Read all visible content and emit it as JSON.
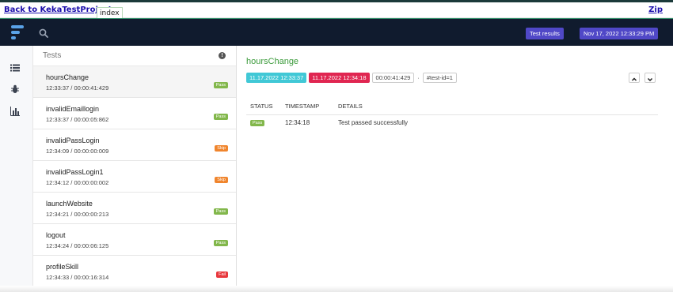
{
  "topbar": {
    "back_link": "Back to KekaTestProject",
    "tab_label": "index",
    "zip_link": "Zip"
  },
  "navbar": {
    "test_results_label": "Test results",
    "date_label": "Nov 17, 2022 12:33:29 PM"
  },
  "test_list": {
    "header": "Tests",
    "items": [
      {
        "name": "hoursChange",
        "time": "12:33:37 / 00:00:41:429",
        "status": "Pass"
      },
      {
        "name": "invalidEmaillogin",
        "time": "12:33:37 / 00:00:05:862",
        "status": "Pass"
      },
      {
        "name": "invalidPassLogin",
        "time": "12:34:09 / 00:00:00:009",
        "status": "Skip"
      },
      {
        "name": "invalidPassLogin1",
        "time": "12:34:12 / 00:00:00:002",
        "status": "Skip"
      },
      {
        "name": "launchWebsite",
        "time": "12:34:21 / 00:00:00:213",
        "status": "Pass"
      },
      {
        "name": "logout",
        "time": "12:34:24 / 00:00:06:125",
        "status": "Pass"
      },
      {
        "name": "profileSkill",
        "time": "12:34:33 / 00:00:16:314",
        "status": "Fail"
      }
    ]
  },
  "detail": {
    "title": "hoursChange",
    "start": "11.17.2022 12:33:37",
    "end": "11.17.2022 12:34:18",
    "duration": "00:00:41:429",
    "separator": "·",
    "test_id": "#test-id=1",
    "columns": {
      "status": "STATUS",
      "timestamp": "TIMESTAMP",
      "details": "DETAILS"
    },
    "log": {
      "status": "Pass",
      "timestamp": "12:34:18",
      "details": "Test passed successfully"
    }
  },
  "colors": {
    "navbar_bg": "#101b2e",
    "accent_purple": "#5048c7",
    "pass": "#82b74b",
    "skip": "#f0852d",
    "fail": "#e8383d",
    "start_chip": "#41c8d6",
    "end_chip": "#e02651",
    "title_green": "#3a9a3a"
  },
  "icons": {
    "logo": "extent-logo-icon",
    "search": "search-icon",
    "sidebar": [
      "list-icon",
      "bug-icon",
      "bar-chart-icon"
    ],
    "info": "info-icon",
    "prev": "chevron-up-icon",
    "next": "chevron-down-icon"
  }
}
